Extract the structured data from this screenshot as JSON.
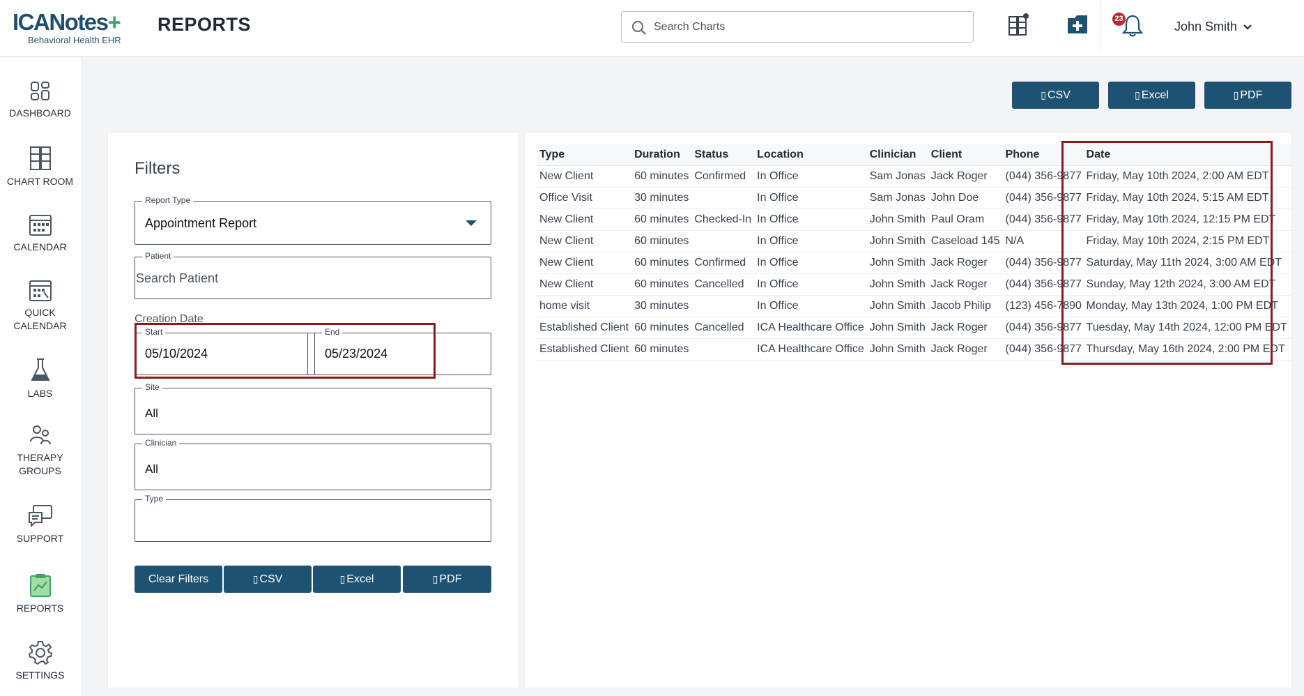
{
  "app": {
    "logo_text": "ICANotes+",
    "logo_subtitle": "Behavioral Health EHR",
    "page_title": "REPORTS"
  },
  "search": {
    "placeholder": "Search Charts"
  },
  "header": {
    "notification_count": "23",
    "user_name": "John Smith",
    "icons": [
      "chart-room-add-icon",
      "medical-folder-icon",
      "bell-icon",
      "chevron-down-icon"
    ]
  },
  "sidebar": {
    "items": [
      {
        "label": "DASHBOARD",
        "icon": "dashboard-icon"
      },
      {
        "label": "CHART ROOM",
        "icon": "file-cabinet-icon"
      },
      {
        "label": "CALENDAR",
        "icon": "calendar-icon"
      },
      {
        "label": "QUICK",
        "label2": "CALENDAR",
        "icon": "quick-calendar-icon"
      },
      {
        "label": "LABS",
        "icon": "flask-icon"
      },
      {
        "label": "THERAPY",
        "label2": "GROUPS",
        "icon": "group-icon"
      },
      {
        "label": "SUPPORT",
        "icon": "chat-icon"
      },
      {
        "label": "REPORTS",
        "icon": "reports-icon",
        "active": true
      },
      {
        "label": "SETTINGS",
        "icon": "gear-icon"
      }
    ]
  },
  "export": {
    "csv": "CSV",
    "excel": "Excel",
    "pdf": "PDF"
  },
  "filters": {
    "title": "Filters",
    "report_type": {
      "label": "Report Type",
      "value": "Appointment Report"
    },
    "patient": {
      "label": "Patient",
      "placeholder": "Search Patient"
    },
    "creation_date": {
      "label": "Creation Date",
      "start_label": "Start",
      "start_value": "05/10/2024",
      "end_label": "End",
      "end_value": "05/23/2024"
    },
    "site": {
      "label": "Site",
      "value": "All"
    },
    "clinician": {
      "label": "Clinician",
      "value": "All"
    },
    "type": {
      "label": "Type",
      "value": ""
    },
    "clear_label": "Clear Filters"
  },
  "table": {
    "headers": [
      "Type",
      "Duration",
      "Status",
      "Location",
      "Clinician",
      "Client",
      "Phone",
      "Date"
    ],
    "rows": [
      [
        "New Client",
        "60 minutes",
        "Confirmed",
        "In Office",
        "Sam Jonas",
        "Jack Roger",
        "(044) 356-9877",
        "Friday, May 10th 2024, 2:00 AM EDT"
      ],
      [
        "Office Visit",
        "30 minutes",
        "",
        "In Office",
        "Sam Jonas",
        "John Doe",
        "(044) 356-9877",
        "Friday, May 10th 2024, 5:15 AM EDT"
      ],
      [
        "New Client",
        "60 minutes",
        "Checked-In",
        "In Office",
        "John Smith",
        "Paul Oram",
        "(044) 356-9877",
        "Friday, May 10th 2024, 12:15 PM EDT"
      ],
      [
        "New Client",
        "60 minutes",
        "",
        "In Office",
        "John Smith",
        "Caseload 145",
        "N/A",
        "Friday, May 10th 2024, 2:15 PM EDT"
      ],
      [
        "New Client",
        "60 minutes",
        "Confirmed",
        "In Office",
        "John Smith",
        "Jack Roger",
        "(044) 356-9877",
        "Saturday, May 11th 2024, 3:00 AM EDT"
      ],
      [
        "New Client",
        "60 minutes",
        "Cancelled",
        "In Office",
        "John Smith",
        "Jack Roger",
        "(044) 356-9877",
        "Sunday, May 12th 2024, 3:00 AM EDT"
      ],
      [
        "home visit",
        "30 minutes",
        "",
        "In Office",
        "John Smith",
        "Jacob Philip",
        "(123) 456-7890",
        "Monday, May 13th 2024, 1:00 PM EDT"
      ],
      [
        "Established Client",
        "60 minutes",
        "Cancelled",
        "ICA Healthcare Office",
        "John Smith",
        "Jack Roger",
        "(044) 356-9877",
        "Tuesday, May 14th 2024, 12:00 PM EDT"
      ],
      [
        "Established Client",
        "60 minutes",
        "",
        "ICA Healthcare Office",
        "John Smith",
        "Jack Roger",
        "(044) 356-9877",
        "Thursday, May 16th 2024, 2:00 PM EDT"
      ]
    ]
  },
  "colors": {
    "primary": "#1d5272",
    "highlight": "#8b1a1a",
    "badge": "#c0262d",
    "active_nav": "#3aa56b"
  }
}
